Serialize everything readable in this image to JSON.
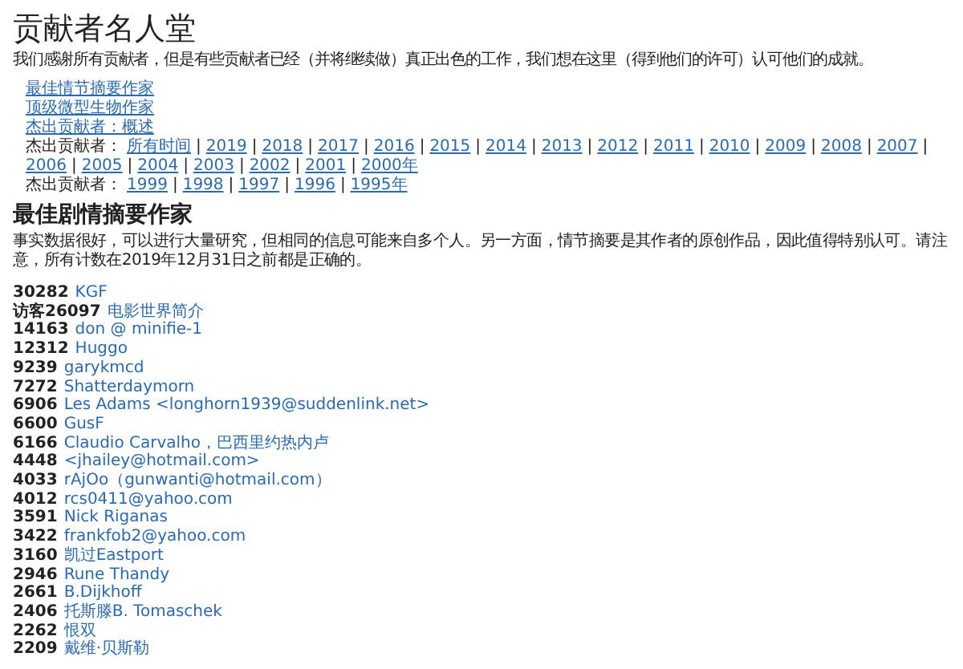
{
  "title": "贡献者名人堂",
  "intro": "我们感谢所有贡献者，但是有些贡献者已经（并将继续做）真正出色的工作，我们想在这里（得到他们的许可）认可他们的成就。",
  "nav_links": [
    "最佳情节摘要作家",
    "顶级微型生物作家",
    "杰出贡献者：概述"
  ],
  "year_rows": [
    {
      "label": "杰出贡献者：",
      "separator": "|",
      "links": [
        "所有时间",
        "2019",
        "2018",
        "2017",
        "2016",
        "2015",
        "2014",
        "2013",
        "2012",
        "2011",
        "2010",
        "2009",
        "2008",
        "2007",
        "2006",
        "2005",
        "2004",
        "2003",
        "2002",
        "2001",
        "2000年"
      ]
    },
    {
      "label": "杰出贡献者：",
      "separator": "|",
      "links": [
        "1999",
        "1998",
        "1997",
        "1996",
        "1995年"
      ]
    }
  ],
  "section": {
    "heading": "最佳剧情摘要作家",
    "description": "事实数据很好，可以进行大量研究，但相同的信息可能来自多个人。另一方面，情节摘要是其作者的原创作品，因此值得特别认可。请注意，所有计数在2019年12月31日之前都是正确的。",
    "entries": [
      {
        "count": "30282",
        "name": "KGF"
      },
      {
        "count": "访客26097",
        "name": "电影世界简介"
      },
      {
        "count": "14163",
        "name": "don @ minifie-1"
      },
      {
        "count": "12312",
        "name": "Huggo"
      },
      {
        "count": "9239",
        "name": "garykmcd"
      },
      {
        "count": "7272",
        "name": "Shatterdaymorn"
      },
      {
        "count": "6906",
        "name": "Les Adams <longhorn1939@suddenlink.net>"
      },
      {
        "count": "6600",
        "name": "GusF"
      },
      {
        "count": "6166",
        "name": "Claudio Carvalho，巴西里约热内卢"
      },
      {
        "count": "4448",
        "name": "<jhailey@hotmail.com>"
      },
      {
        "count": "4033",
        "name": "rAjOo（gunwanti@hotmail.com）"
      },
      {
        "count": "4012",
        "name": "rcs0411@yahoo.com"
      },
      {
        "count": "3591",
        "name": "Nick Riganas"
      },
      {
        "count": "3422",
        "name": "frankfob2@yahoo.com"
      },
      {
        "count": "3160",
        "name": "凯过Eastport"
      },
      {
        "count": "2946",
        "name": "Rune Thandy"
      },
      {
        "count": "2661",
        "name": "B.Dijkhoff"
      },
      {
        "count": "2406",
        "name": "托斯滕B. Tomaschek"
      },
      {
        "count": "2262",
        "name": "恨双"
      },
      {
        "count": "2209",
        "name": "戴维·贝斯勒"
      }
    ]
  }
}
